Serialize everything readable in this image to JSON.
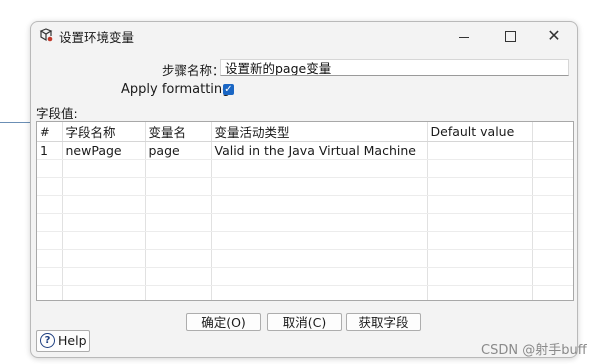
{
  "window": {
    "title": "设置环境变量",
    "controls": {
      "minimize_icon": "minimize-icon",
      "maximize_icon": "maximize-icon",
      "close_icon": "close-icon",
      "close_glyph": "✕"
    }
  },
  "form": {
    "step_name_label": "步骤名称：",
    "step_name_value": "设置新的page变量",
    "apply_formatting_label": "Apply formatting",
    "apply_formatting_checked": true,
    "check_glyph": "✓",
    "field_values_label": "字段值:"
  },
  "table": {
    "columns": [
      "#",
      "字段名称",
      "变量名",
      "变量活动类型",
      "Default value"
    ],
    "rows": [
      {
        "index": "1",
        "field_name": "newPage",
        "variable_name": "page",
        "variable_type": "Valid in the Java Virtual Machine",
        "default_value": ""
      }
    ]
  },
  "buttons": {
    "ok": "确定(O)",
    "cancel": "取消(C)",
    "get_fields": "获取字段",
    "help": "Help",
    "help_glyph": "?"
  },
  "watermark": "CSDN @射手buff",
  "colors": {
    "accent": "#1a66c4",
    "help_icon": "#1e3f80"
  }
}
